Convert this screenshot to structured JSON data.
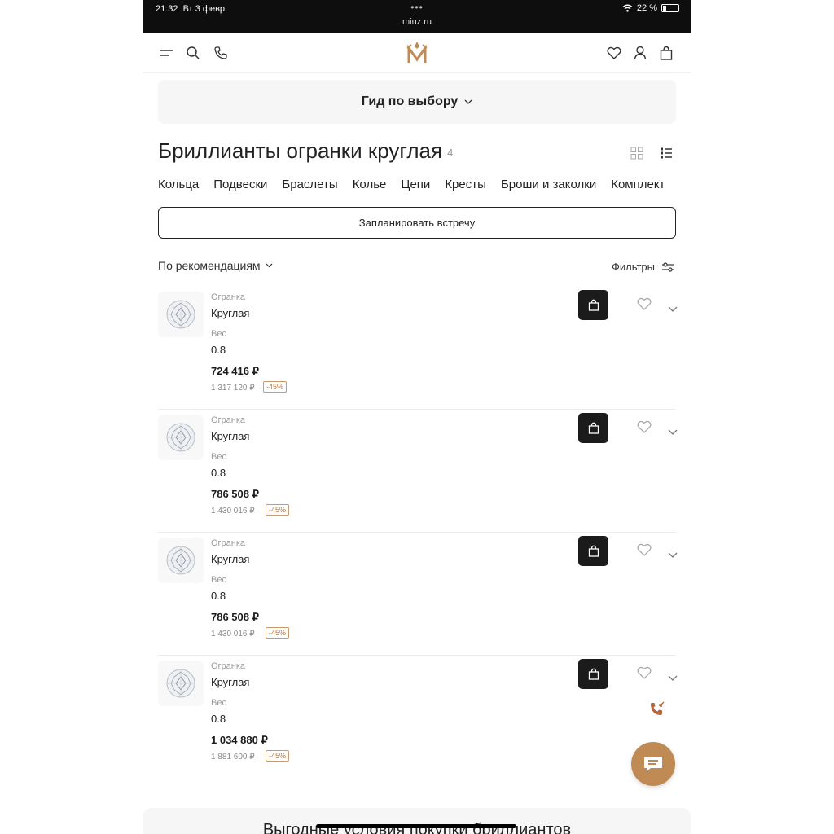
{
  "status_bar": {
    "time": "21:32",
    "date": "Вт 3 февр.",
    "dots": "•••",
    "url": "miuz.ru",
    "battery": "22 %"
  },
  "header": {
    "icons": [
      "menu-icon",
      "search-icon",
      "phone-icon",
      "logo",
      "heart-icon",
      "user-icon",
      "bag-icon"
    ]
  },
  "guide": {
    "label": "Гид по выбору"
  },
  "page": {
    "title": "Бриллианты огранки круглая",
    "count": "4"
  },
  "categories": [
    "Кольца",
    "Подвески",
    "Браслеты",
    "Колье",
    "Цепи",
    "Кресты",
    "Броши и заколки",
    "Комплект"
  ],
  "meeting_button": "Запланировать встречу",
  "sort": {
    "label": "По рекомендациям"
  },
  "filters": {
    "label": "Фильтры"
  },
  "products": [
    {
      "cut_label": "Огранка",
      "cut": "Круглая",
      "weight_label": "Вес",
      "weight": "0.8",
      "price": "724 416 ₽",
      "old_price": "1 317 120 ₽",
      "discount": "-45%"
    },
    {
      "cut_label": "Огранка",
      "cut": "Круглая",
      "weight_label": "Вес",
      "weight": "0.8",
      "price": "786 508 ₽",
      "old_price": "1 430 016 ₽",
      "discount": "-45%"
    },
    {
      "cut_label": "Огранка",
      "cut": "Круглая",
      "weight_label": "Вес",
      "weight": "0.8",
      "price": "786 508 ₽",
      "old_price": "1 430 016 ₽",
      "discount": "-45%"
    },
    {
      "cut_label": "Огранка",
      "cut": "Круглая",
      "weight_label": "Вес",
      "weight": "0.8",
      "price": "1 034 880 ₽",
      "old_price": "1 881 600 ₽",
      "discount": "-45%"
    }
  ],
  "promo": {
    "text": "Выгодные условия покупки бриллиантов"
  },
  "colors": {
    "accent": "#c08a55",
    "dark_button": "#1b1b1b",
    "discount": "#b07b4a"
  }
}
